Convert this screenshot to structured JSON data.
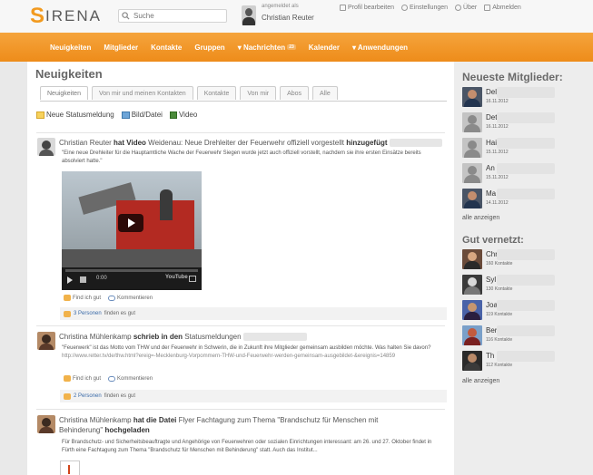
{
  "app": {
    "logo_text": "SIRENA",
    "search_placeholder": "Suche",
    "user_status": "angemeldet als",
    "user_name": "Christian Reuter",
    "top_links": {
      "profile": "Profil bearbeiten",
      "settings": "Einstellungen",
      "about": "Über",
      "logout": "Abmelden"
    }
  },
  "nav": {
    "items": [
      {
        "label": "Neuigkeiten"
      },
      {
        "label": "Mitglieder"
      },
      {
        "label": "Kontakte"
      },
      {
        "label": "Gruppen"
      },
      {
        "label": "▾ Nachrichten"
      },
      {
        "label": "Kalender"
      },
      {
        "label": "▾ Anwendungen"
      }
    ],
    "messages_badge": "23"
  },
  "main": {
    "title": "Neuigkeiten",
    "tabs": [
      {
        "label": "Neuigkeiten",
        "active": true
      },
      {
        "label": "Von mir und meinen Kontakten",
        "active": false
      },
      {
        "label": "Kontakte",
        "active": false
      },
      {
        "label": "Von mir",
        "active": false
      },
      {
        "label": "Abos",
        "active": false
      },
      {
        "label": "Alle",
        "active": false
      }
    ],
    "compose": {
      "status": "Neue Statusmeldung",
      "file": "Bild/Datei",
      "video": "Video"
    },
    "posts": [
      {
        "author": "Christian Reuter",
        "verb": "hat",
        "object_type": "Video",
        "object_title": "Weidenau: Neue Drehleiter der Feuerwehr offiziell vorgestellt",
        "suffix": "hinzugefügt",
        "text": "\"Eine neue Drehleiter für die Hauptamtliche Wache der Feuerwehr Siegen wurde jetzt auch offiziell vorstellt, nachdem sie ihre ersten Einsätze bereits absolviert hatte.\"",
        "video_time": "0:00",
        "video_brand": "YouTube",
        "like_label": "Find ich gut",
        "comment_label": "Kommentieren",
        "likes_count": "3 Personen",
        "likes_suffix": "finden es gut"
      },
      {
        "author": "Christina Mühlenkamp",
        "verb": "schrieb in den",
        "object_title": "Statusmeldungen",
        "text": "\"Feuerwerk\" ist das Motto vom THW und der Feuerwehr in Schwerin, die in Zukunft ihre Mitglieder gemeinsam ausbilden möchte. Was halten Sie davon?",
        "link": "http://www.retter.tv/de/thw.html?ereig=-Mecklenburg-Vorpommern-THW-und-Feuerwehr-werden-gemeinsam-ausgebildet-&ereignis=14859",
        "like_label": "Find ich gut",
        "comment_label": "Kommentieren",
        "likes_count": "2 Personen",
        "likes_suffix": "finden es gut"
      },
      {
        "author": "Christina Mühlenkamp",
        "verb": "hat die Datei",
        "object_title": "Flyer Fachtagung zum Thema \"Brandschutz für Menschen mit Behinderung\"",
        "suffix": "hochgeladen",
        "text": "Für Brandschutz- und Sicherheitsbeauftragte und Angehörige von Feuerwehren oder sozialen Einrichtungen interessant: am 26. und 27. Oktober findet in Fürth eine Fachtagung zum Thema \"Brandschutz für Menschen mit Behinderung\" statt. Auch das Institut..."
      }
    ]
  },
  "sidebar": {
    "newest_title": "Neueste Mitglieder:",
    "newest": [
      {
        "name": "Del",
        "date": "16.11.2012"
      },
      {
        "name": "Det",
        "date": "16.11.2012"
      },
      {
        "name": "Hai",
        "date": "15.11.2012"
      },
      {
        "name": "An",
        "date": "15.11.2012"
      },
      {
        "name": "Ma",
        "date": "14.11.2012"
      }
    ],
    "show_all": "alle anzeigen",
    "connected_title": "Gut vernetzt:",
    "connected": [
      {
        "name": "Chr",
        "contacts": "160 Kontakte"
      },
      {
        "name": "Syl",
        "contacts": "130 Kontakte"
      },
      {
        "name": "Joa",
        "contacts": "119 Kontakte"
      },
      {
        "name": "Ber",
        "contacts": "116 Kontakte"
      },
      {
        "name": "Th",
        "contacts": "112 Kontakte"
      }
    ],
    "show_all_2": "alle anzeigen"
  },
  "colors": {
    "brand_orange": "#f29a1f",
    "nav_orange": "#ee8c1a"
  }
}
